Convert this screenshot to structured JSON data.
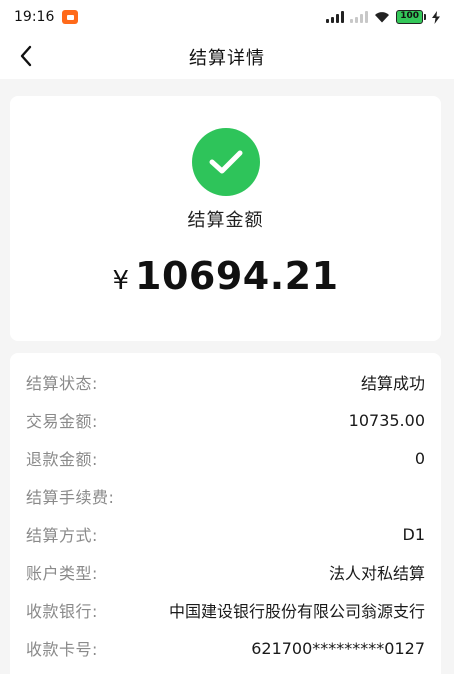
{
  "status_bar": {
    "time": "19:16",
    "battery": "100",
    "icons": [
      "notification-app-icon",
      "signal-icon",
      "signal-no-sim-icon",
      "wifi-icon",
      "battery-icon",
      "charging-icon"
    ]
  },
  "nav": {
    "title": "结算详情",
    "back_icon": "chevron-left-icon"
  },
  "summary": {
    "status_icon": "check-circle-icon",
    "status_color": "#2ec45a",
    "label": "结算金额",
    "currency": "¥",
    "amount": "10694.21"
  },
  "details": [
    {
      "label": "结算状态:",
      "value": "结算成功"
    },
    {
      "label": "交易金额:",
      "value": "10735.00"
    },
    {
      "label": "退款金额:",
      "value": "0"
    },
    {
      "label": "结算手续费:",
      "value": ""
    },
    {
      "label": "结算方式:",
      "value": "D1"
    },
    {
      "label": "账户类型:",
      "value": "法人对私结算"
    },
    {
      "label": "收款银行:",
      "value": "中国建设银行股份有限公司翁源支行"
    },
    {
      "label": "收款卡号:",
      "value": "621700*********0127"
    }
  ]
}
